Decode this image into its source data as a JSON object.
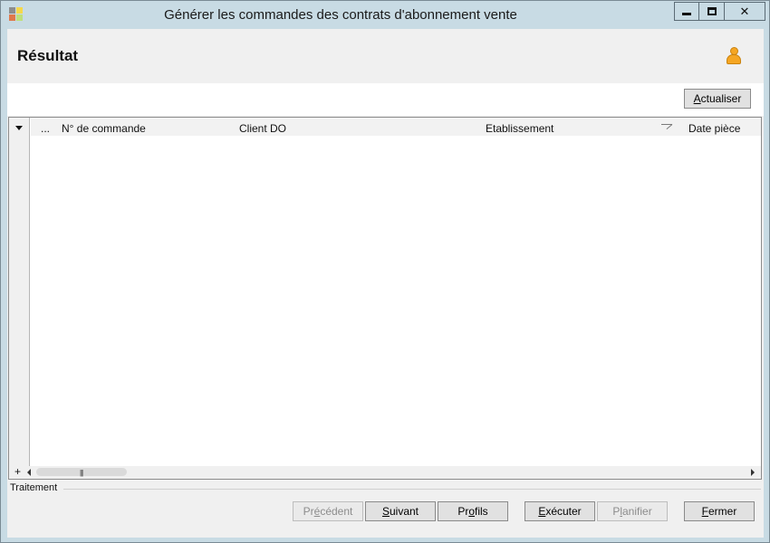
{
  "window": {
    "title": "Générer les commandes des contrats d'abonnement vente",
    "controls": {
      "minimize": "minimize",
      "maximize": "maximize",
      "close": "✕"
    }
  },
  "header": {
    "title": "Résultat",
    "user_icon": "user-icon"
  },
  "toolbar": {
    "refresh_first": "A",
    "refresh_rest": "ctualiser"
  },
  "grid": {
    "row_selector": "▾",
    "columns": [
      {
        "label": "..."
      },
      {
        "label": "N° de commande"
      },
      {
        "label": "Client DO"
      },
      {
        "label": "Etablissement"
      },
      {
        "label": "Date pièce"
      }
    ],
    "rows": [],
    "footer_add": "+",
    "scroll_grip": "|||"
  },
  "processing": {
    "label": "Traitement"
  },
  "buttons": {
    "previous": {
      "pre": "Pr",
      "key": "é",
      "post": "cédent",
      "disabled": true
    },
    "next": {
      "pre": "",
      "key": "S",
      "post": "uivant",
      "disabled": false
    },
    "profiles": {
      "pre": "Pr",
      "key": "o",
      "post": "fils",
      "disabled": false
    },
    "execute": {
      "pre": "",
      "key": "E",
      "post": "xécuter",
      "disabled": false
    },
    "schedule": {
      "pre": "P",
      "key": "l",
      "post": "anifier",
      "disabled": true
    },
    "close": {
      "pre": "",
      "key": "F",
      "post": "ermer",
      "disabled": false
    }
  },
  "colors": {
    "titlebar": "#c8dbe4",
    "panel": "#f0f0f0",
    "user_icon": "#f5a623"
  }
}
